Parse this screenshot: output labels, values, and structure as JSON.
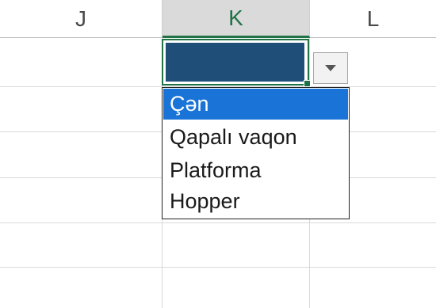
{
  "columns": [
    {
      "label": "J",
      "selected": false
    },
    {
      "label": "K",
      "selected": true
    },
    {
      "label": "L",
      "selected": false
    }
  ],
  "active_cell": {
    "fill_color": "#1f4e79",
    "border_color": "#217346"
  },
  "dropdown": {
    "button_icon": "chevron-down-icon",
    "selected_index": 0,
    "options": [
      "Çən",
      "Qapalı vaqon",
      "Platforma",
      "Hopper"
    ]
  },
  "colors": {
    "selected_option": "#1a73d6",
    "header_accent": "#217346"
  }
}
